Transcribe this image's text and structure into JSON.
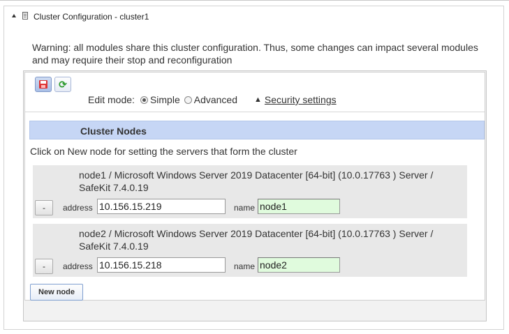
{
  "panel": {
    "title": "Cluster Configuration - cluster1",
    "collapse_icon": "collapse-triangle-icon",
    "doc_icon": "document-icon"
  },
  "warning": "Warning: all modules share this cluster configuration. Thus, some changes can impact several modules and may require their stop and reconfiguration",
  "toolbar": {
    "save_icon": "floppy-save-icon",
    "refresh_icon": "refresh-icon",
    "refresh_glyph": "⟳"
  },
  "edit_mode": {
    "label": "Edit mode:",
    "options": [
      "Simple",
      "Advanced"
    ],
    "selected": "Simple",
    "warn_glyph": "▲",
    "security_link": "Security settings"
  },
  "nodes_section": {
    "header": "Cluster Nodes",
    "hint": "Click on New node for setting the servers that form the cluster",
    "address_label": "address",
    "name_label": "name",
    "remove_label": "-",
    "nodes": [
      {
        "description": "node1 / Microsoft Windows Server 2019 Datacenter [64-bit] (10.0.17763 ) Server / SafeKit 7.4.0.19",
        "address": "10.156.15.219",
        "name": "node1"
      },
      {
        "description": "node2 / Microsoft Windows Server 2019 Datacenter [64-bit] (10.0.17763 ) Server / SafeKit 7.4.0.19",
        "address": "10.156.15.218",
        "name": "node2"
      }
    ],
    "new_node_button": "New node"
  },
  "colors": {
    "section_header_bg": "#c6d6f5",
    "name_field_bg": "#e0fbdd",
    "node_card_bg": "#e8e8e8"
  }
}
